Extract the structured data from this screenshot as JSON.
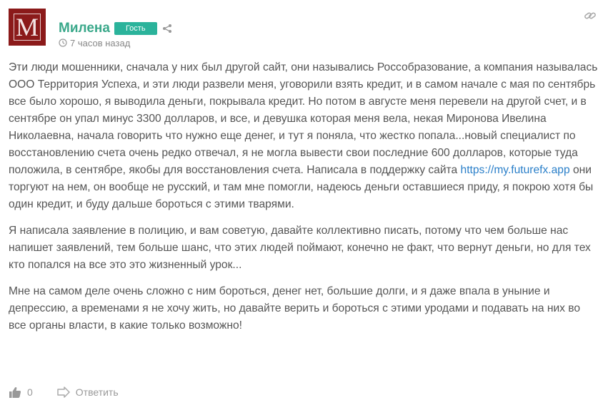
{
  "author": {
    "name": "Милена",
    "avatar_letter": "M",
    "avatar_color": "#8b1a1a",
    "badge": "Гость",
    "badge_color": "#2bb39b",
    "time": "7 часов назад"
  },
  "icons": {
    "share": "share-icon",
    "clock": "clock-icon",
    "permalink": "link-icon",
    "like": "thumbs-up-icon",
    "reply": "reply-arrow-icon"
  },
  "body": {
    "p1_before_link": "Эти люди мошенники, сначала у них был другой сайт, они назывались Россобразование, а компания называлась ООО Территория Успеха, и эти люди развели меня, уговорили взять кредит, и в самом начале с мая по сентябрь все было хорошо, я выводила деньги, покрывала кредит. Но потом в августе меня перевели на другой счет, и в сентябре он упал минус 3300 долларов, и все, и девушка которая меня вела, некая Миронова Ивелина Николаевна, начала говорить что нужно еще денег, и тут я поняла, что жестко попала...новый специалист по восстановлению счета очень редко отвечал, я не могла вывести свои последние 600 долларов, которые туда положила, в сентябре, якобы для восстановления счета. Написала в поддержку сайта ",
    "link_text": "https://my.futurefx.app",
    "p1_after_link": " они торгуют на нем, он вообще не русский, и там мне помогли, надеюсь деньги оставшиеся приду, я покрою хотя бы один кредит, и буду дальше бороться с этими тварями.",
    "p2": "Я написала заявление в полицию, и вам советую, давайте коллективно писать, потому что чем больше нас напишет заявлений, тем больше шанс, что этих людей поймают, конечно не факт, что вернут деньги, но для тех кто попался на все это это жизненный урок...",
    "p3": "Мне на самом деле очень сложно с ним бороться, денег нет, большие долги, и я даже впала в уныние и депрессию, а временами я не хочу жить, но давайте верить и бороться с этими уродами и подавать на них во все органы власти, в какие только возможно!"
  },
  "actions": {
    "like_count": "0",
    "reply_label": "Ответить"
  }
}
